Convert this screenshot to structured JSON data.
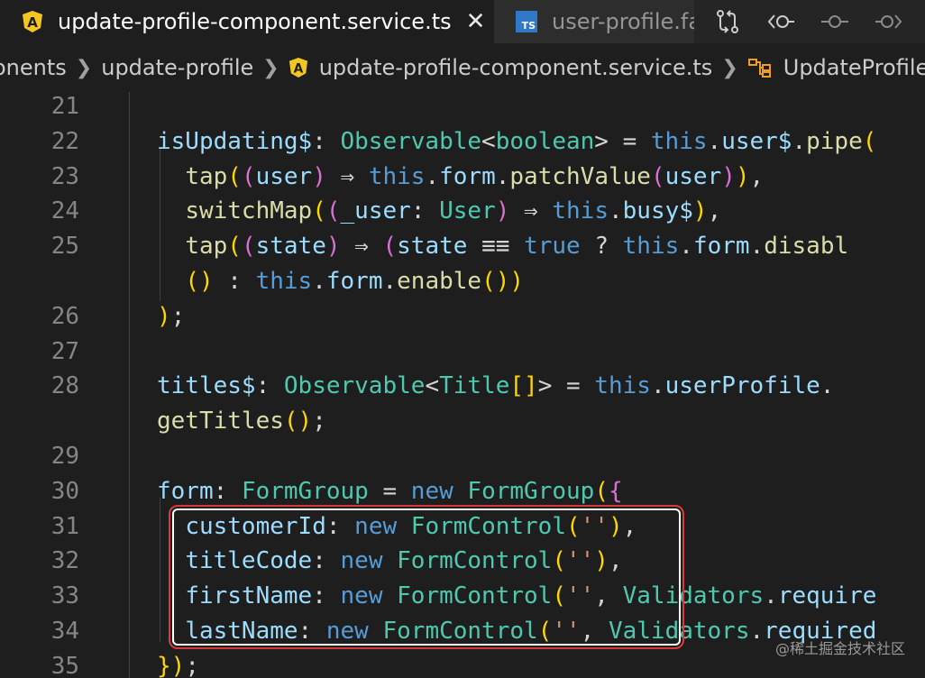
{
  "tabs": [
    {
      "label": "update-profile-component.service.ts",
      "icon": "angular-icon",
      "active": true
    },
    {
      "label": "user-profile.fa",
      "icon": "typescript-icon",
      "active": false
    }
  ],
  "ts_icon_text": "TS",
  "close_glyph": "✕",
  "breadcrumb": {
    "items": [
      "onents",
      "update-profile",
      "update-profile-component.service.ts",
      "UpdateProfileC"
    ]
  },
  "editor": {
    "line_numbers": [
      "21",
      "22",
      "23",
      "24",
      "25",
      "",
      "26",
      "27",
      "28",
      "",
      "29",
      "30",
      "31",
      "32",
      "33",
      "34",
      "35"
    ],
    "lines": [
      "",
      "isUpdating$: Observable<boolean> = this.user$.pipe(",
      "  tap((user) ⇒ this.form.patchValue(user)),",
      "  switchMap((_user: User) ⇒ this.busy$),",
      "  tap((state) ⇒ (state ≡≡ true ? this.form.disabl",
      "  () : this.form.enable())",
      ");",
      "",
      "titles$: Observable<Title[]> = this.userProfile.",
      "getTitles();",
      "",
      "form: FormGroup = new FormGroup({",
      "  customerId: new FormControl(''),",
      "  titleCode: new FormControl(''),",
      "  firstName: new FormControl('', Validators.require",
      "  lastName: new FormControl('', Validators.required",
      "});"
    ]
  },
  "watermark": "@稀土掘金技术社区",
  "colors": {
    "background": "#1e1e1e",
    "keyword": "#569cd6",
    "property": "#9cdcfe",
    "type": "#4ec9b0",
    "function": "#dcdcaa",
    "highlight_border": "#d83a3a"
  }
}
